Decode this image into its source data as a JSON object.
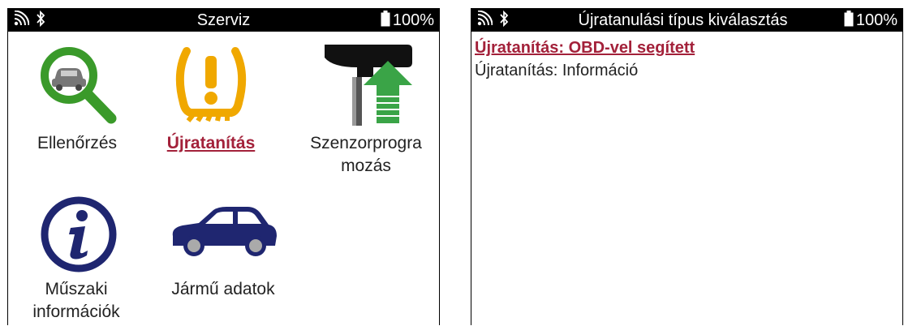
{
  "left_screen": {
    "status_bar": {
      "title": "Szerviz",
      "battery": "100%",
      "icons": [
        "wireless-signal-icon",
        "bluetooth-icon",
        "battery-icon"
      ]
    },
    "tiles": [
      {
        "label": "Ellenőrzés",
        "icon": "magnifier-car-icon",
        "selected": false
      },
      {
        "label": "Újratanítás",
        "icon": "tpms-warning-icon",
        "selected": true
      },
      {
        "label": "Szenzorprogramozás",
        "icon": "sensor-program-icon",
        "selected": false
      },
      {
        "label": "Műszaki információk",
        "icon": "info-icon",
        "selected": false
      },
      {
        "label": "Jármű adatok",
        "icon": "car-icon",
        "selected": false
      }
    ]
  },
  "right_screen": {
    "status_bar": {
      "title": "Újratanulási típus kiválasztás",
      "battery": "100%",
      "icons": [
        "wireless-signal-icon",
        "bluetooth-icon",
        "battery-icon"
      ]
    },
    "items": [
      {
        "label": "Újratanítás: OBD-vel segített",
        "selected": true
      },
      {
        "label": "Újratanítás: Információ",
        "selected": false
      }
    ]
  },
  "colors": {
    "selection": "#a3213a",
    "magnifier_green": "#3a9a2a",
    "warning_yellow": "#f0a800",
    "arrow_green": "#3aa447",
    "navy": "#1f2670"
  }
}
